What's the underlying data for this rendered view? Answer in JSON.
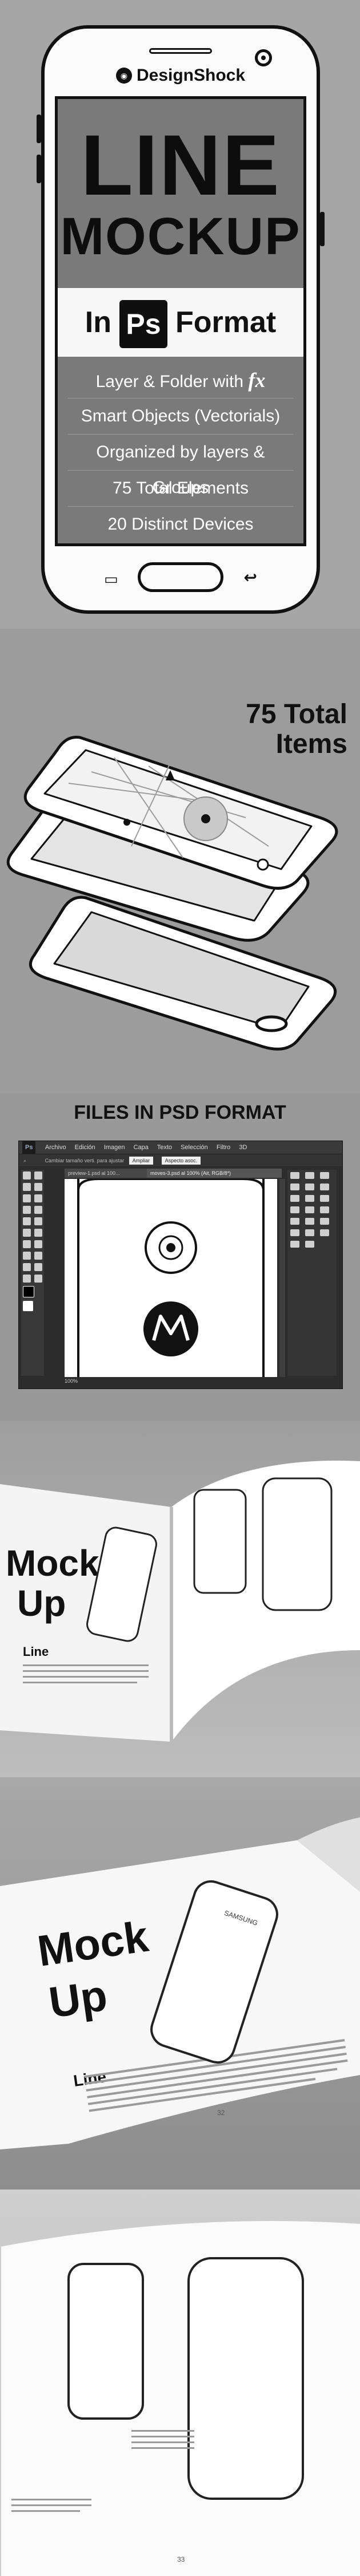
{
  "hero": {
    "brand": "DesignShock",
    "brand_mark": "◉",
    "title_line1": "LINE",
    "title_line2": "MOCKUP",
    "in_label": "In",
    "ps_label": "Ps",
    "format_label": "Format",
    "features": [
      {
        "text": "Layer & Folder with",
        "fx": "fx"
      },
      {
        "text": "Smart Objects (Vectorials)"
      },
      {
        "text": "Organized by layers & Groups"
      },
      {
        "text": "75 Total Elements"
      },
      {
        "text": "20 Distinct Devices"
      }
    ],
    "nav_recent_icon": "recent-apps-icon",
    "nav_back_icon": "back-icon"
  },
  "items": {
    "title_line1": "75 Total",
    "title_line2": "Items"
  },
  "psd": {
    "title": "FILES IN PSD FORMAT",
    "app_logo": "Ps",
    "menu": [
      "Archivo",
      "Edición",
      "Imagen",
      "Capa",
      "Texto",
      "Selección",
      "Filtro",
      "3D"
    ],
    "option_text": "Cambiar tamaño verti. para ajustar",
    "option_box": "Ampliar",
    "option_box2": "Aspecto asoc.",
    "tab_left": "preview-1.psd al 100...",
    "tab_right": "moves-3.psd al 100% (Ait, RGB/8*)",
    "zoom": "100%",
    "logo_icon": "motorola-logo-icon"
  },
  "book1": {
    "mock": "Mock",
    "up": "Up",
    "line": "Line"
  },
  "book2": {
    "mock": "Mock",
    "up": "Up",
    "line": "Line",
    "page_num": "32",
    "brand": "SAMSUNG"
  },
  "book3": {
    "page_num": "33"
  },
  "colors": {
    "dark": "#111111",
    "screen": "#7a7a7a",
    "bg": "#a6a6a6"
  }
}
